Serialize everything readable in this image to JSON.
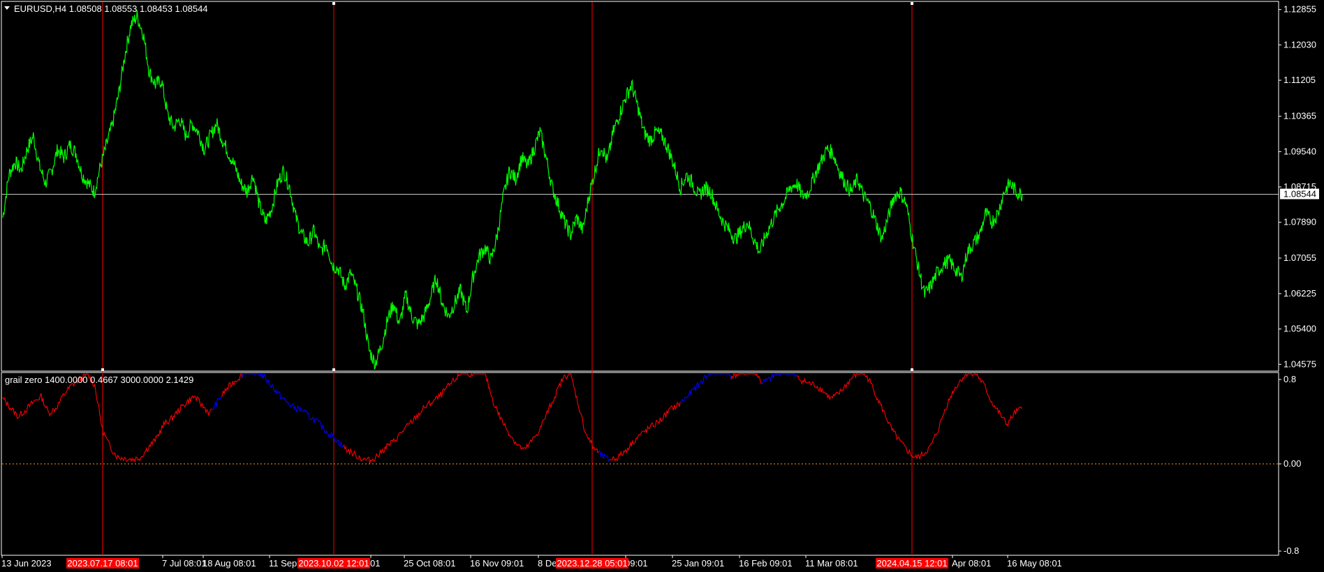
{
  "chart_data": [
    {
      "type": "line",
      "title": "EURUSD,H4  1.08508 1.08553 1.08453 1.08544",
      "symbol": "EURUSD,H4",
      "ohlc": {
        "open": 1.08508,
        "high": 1.08553,
        "low": 1.08453,
        "close": 1.08544
      },
      "series": [
        {
          "color": "#00ff00",
          "x_labels_ref": "shared_x_axis",
          "values": [
            1.08,
            1.09,
            1.093,
            1.091,
            1.096,
            1.099,
            1.092,
            1.088,
            1.091,
            1.096,
            1.094,
            1.097,
            1.095,
            1.09,
            1.088,
            1.086,
            1.092,
            1.097,
            1.102,
            1.109,
            1.118,
            1.125,
            1.127,
            1.123,
            1.114,
            1.111,
            1.112,
            1.104,
            1.101,
            1.103,
            1.099,
            1.102,
            1.1,
            1.096,
            1.099,
            1.102,
            1.098,
            1.095,
            1.092,
            1.088,
            1.086,
            1.09,
            1.083,
            1.079,
            1.082,
            1.088,
            1.091,
            1.087,
            1.08,
            1.076,
            1.074,
            1.077,
            1.072,
            1.074,
            1.069,
            1.068,
            1.064,
            1.067,
            1.063,
            1.058,
            1.049,
            1.046,
            1.05,
            1.056,
            1.06,
            1.055,
            1.062,
            1.057,
            1.055,
            1.057,
            1.061,
            1.066,
            1.06,
            1.057,
            1.06,
            1.063,
            1.058,
            1.066,
            1.071,
            1.073,
            1.07,
            1.076,
            1.085,
            1.091,
            1.089,
            1.094,
            1.092,
            1.096,
            1.1,
            1.094,
            1.087,
            1.083,
            1.079,
            1.076,
            1.08,
            1.077,
            1.085,
            1.091,
            1.097,
            1.093,
            1.1,
            1.104,
            1.108,
            1.111,
            1.106,
            1.1,
            1.098,
            1.1,
            1.099,
            1.096,
            1.092,
            1.087,
            1.09,
            1.088,
            1.085,
            1.087,
            1.086,
            1.082,
            1.079,
            1.077,
            1.075,
            1.077,
            1.079,
            1.075,
            1.072,
            1.076,
            1.079,
            1.082,
            1.084,
            1.087,
            1.088,
            1.085,
            1.086,
            1.09,
            1.093,
            1.096,
            1.095,
            1.091,
            1.088,
            1.086,
            1.089,
            1.085,
            1.083,
            1.079,
            1.075,
            1.08,
            1.085,
            1.086,
            1.083,
            1.075,
            1.068,
            1.062,
            1.064,
            1.067,
            1.069,
            1.07,
            1.068,
            1.066,
            1.072,
            1.074,
            1.076,
            1.081,
            1.079,
            1.081,
            1.086,
            1.088,
            1.086,
            1.0854
          ]
        }
      ],
      "current_price_label": "1.08544",
      "ylim": [
        1.0445,
        1.1298
      ],
      "yticks": [
        "1.12855",
        "1.12030",
        "1.11205",
        "1.10365",
        "1.09540",
        "1.08715",
        "1.07890",
        "1.07055",
        "1.06225",
        "1.05400",
        "1.04575"
      ],
      "ytick_values": [
        1.12855,
        1.1203,
        1.11205,
        1.10365,
        1.0954,
        1.08715,
        1.0789,
        1.07055,
        1.06225,
        1.054,
        1.04575
      ],
      "grid": false
    },
    {
      "type": "line",
      "title": "grail zero 1400.0000 0.4667 3000.0000 2.1429",
      "indicator": "grail zero",
      "params": [
        1400.0,
        0.4667,
        3000.0,
        2.1429
      ],
      "series": [
        {
          "color_above": "#ff0000",
          "color_below": "#0000ff",
          "values": [
            0.58,
            0.5,
            0.42,
            0.48,
            0.55,
            0.6,
            0.45,
            0.5,
            0.62,
            0.7,
            0.75,
            0.8,
            0.7,
            0.3,
            0.15,
            0.06,
            0.05,
            0.04,
            0.06,
            0.15,
            0.22,
            0.35,
            0.4,
            0.48,
            0.55,
            0.6,
            0.52,
            0.45,
            0.55,
            0.65,
            0.72,
            0.78,
            0.85,
            0.82,
            0.78,
            0.7,
            0.62,
            0.55,
            0.5,
            0.48,
            0.42,
            0.38,
            0.3,
            0.25,
            0.18,
            0.12,
            0.08,
            0.04,
            0.03,
            0.08,
            0.15,
            0.2,
            0.28,
            0.35,
            0.42,
            0.5,
            0.55,
            0.6,
            0.68,
            0.75,
            0.82,
            0.8,
            0.85,
            0.78,
            0.55,
            0.4,
            0.28,
            0.18,
            0.12,
            0.2,
            0.3,
            0.45,
            0.6,
            0.75,
            0.82,
            0.55,
            0.28,
            0.15,
            0.08,
            0.04,
            0.05,
            0.1,
            0.18,
            0.25,
            0.3,
            0.35,
            0.4,
            0.48,
            0.52,
            0.58,
            0.65,
            0.72,
            0.8,
            0.82,
            0.85,
            0.78,
            0.8,
            0.82,
            0.84,
            0.72,
            0.75,
            0.8,
            0.83,
            0.8,
            0.75,
            0.72,
            0.7,
            0.65,
            0.58,
            0.62,
            0.7,
            0.78,
            0.82,
            0.75,
            0.6,
            0.45,
            0.3,
            0.2,
            0.12,
            0.05,
            0.08,
            0.15,
            0.3,
            0.5,
            0.65,
            0.75,
            0.82,
            0.8,
            0.7,
            0.55,
            0.45,
            0.35,
            0.45,
            0.5
          ]
        }
      ],
      "ylim": [
        -0.8,
        0.8
      ],
      "yticks": [
        "0.8",
        "0.00",
        "-0.8"
      ],
      "ytick_values": [
        0.8,
        0.0,
        -0.8
      ],
      "zero_line_color": "#ffa500",
      "grid": false
    }
  ],
  "shared_x_axis": {
    "tick_labels": [
      "13 Jun 2023",
      "7 Jul 08:01",
      "18 Aug 08:01",
      "11 Sep",
      "01",
      "25 Oct 08:01",
      "16 Nov 09:01",
      "8 De",
      "09:01",
      "25 Jan 09:01",
      "16 Feb 09:01",
      "11 Mar 08:01",
      "Apr 08:01",
      "16 May 08:01"
    ],
    "marker_labels": [
      "2023.07.17 08:01",
      "2023.10.02 12:01",
      "2023.12.28 05:01",
      "2024.04.15 12:01"
    ],
    "marker_color": "#ff0000"
  },
  "colors": {
    "background": "#000000",
    "border": "#ffffff",
    "price_line": "#00ff00",
    "marker_line": "#ff0000",
    "label_bg_marker": "#ff0000"
  }
}
